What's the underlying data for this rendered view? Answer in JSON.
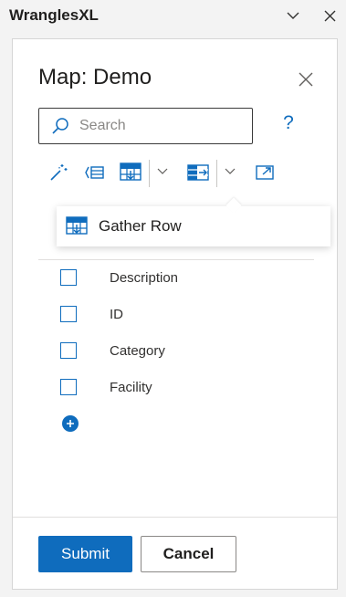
{
  "app": {
    "title": "WranglesXL"
  },
  "panel": {
    "title": "Map: Demo",
    "search": {
      "placeholder": "Search",
      "value": ""
    },
    "help_label": "?"
  },
  "toolbar": {
    "icons": [
      "magic-wand-icon",
      "split-columns-icon",
      "gather-row-icon",
      "chevron-down-icon",
      "merge-columns-icon",
      "chevron-down-icon",
      "open-external-icon"
    ]
  },
  "dropdown": {
    "item_label": "Gather Row"
  },
  "columns": [
    {
      "label": "Description",
      "checked": false
    },
    {
      "label": "ID",
      "checked": false
    },
    {
      "label": "Category",
      "checked": false
    },
    {
      "label": "Facility",
      "checked": false
    }
  ],
  "footer": {
    "submit_label": "Submit",
    "cancel_label": "Cancel"
  },
  "colors": {
    "accent": "#0f6cbd",
    "background": "#f3f3f3",
    "panel": "#ffffff"
  }
}
